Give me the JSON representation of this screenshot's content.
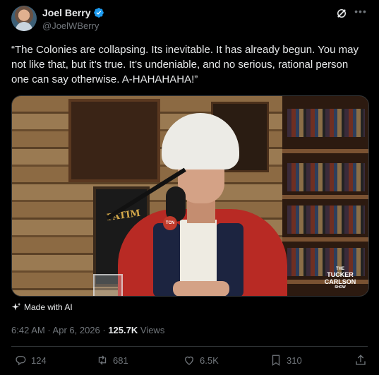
{
  "author": {
    "name": "Joel Berry",
    "handle": "@JoelWBerry",
    "verified": true
  },
  "tweet": {
    "text": "“The Colonies are collapsing. Its inevitable. It has already begun. You may not like that, but it’s true. It’s undeniable, and no serious, rational person one can say otherwise. A-HAHAHAHA!”"
  },
  "media": {
    "poster_text": "FATIM",
    "mic_tag": "TCN",
    "watermark": {
      "the": "THE",
      "tucker": "TUCKER",
      "carlson": "CARLSON",
      "show": "SHOW"
    }
  },
  "made_with_ai": "Made with AI",
  "meta": {
    "time": "6:42 AM",
    "separator": " · ",
    "date": "Apr 6, 2026",
    "views_count": "125.7K",
    "views_label": "Views"
  },
  "actions": {
    "replies": "124",
    "reposts": "681",
    "likes": "6.5K",
    "bookmarks": "310"
  },
  "colors": {
    "background": "#000000",
    "text": "#e7e9ea",
    "secondary": "#71767b",
    "verified": "#1d9bf0"
  },
  "icons": [
    "verified-badge-icon",
    "grok-icon",
    "more-icon",
    "sparkle-icon",
    "reply-icon",
    "repost-icon",
    "like-icon",
    "bookmark-icon",
    "share-icon"
  ]
}
